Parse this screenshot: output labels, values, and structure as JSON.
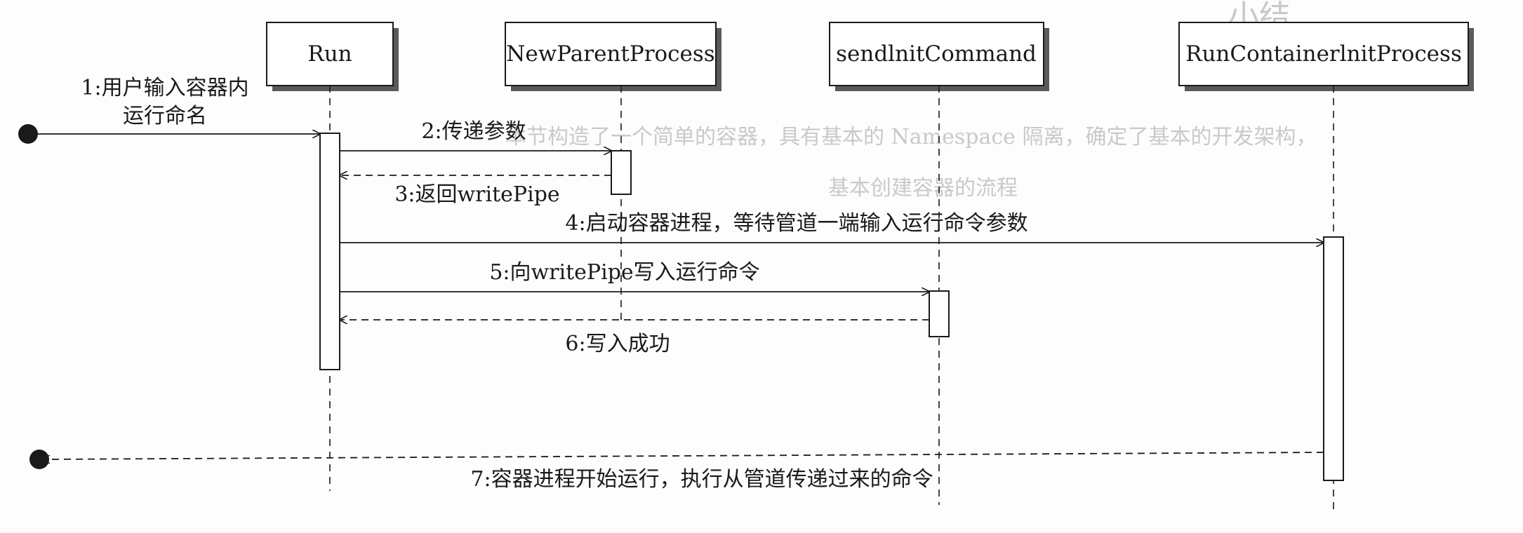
{
  "participants": [
    {
      "id": "run",
      "label": "Run"
    },
    {
      "id": "npp",
      "label": "NewParentProcess"
    },
    {
      "id": "sic",
      "label": "sendlnitCommand"
    },
    {
      "id": "rcip",
      "label": "RunContainerlnitProcess"
    }
  ],
  "messages": [
    {
      "id": "m1",
      "label_lines": [
        "1:用户输入容器内",
        "运行命名"
      ]
    },
    {
      "id": "m2",
      "label": "2:传递参数"
    },
    {
      "id": "m3",
      "label": "3:返回writePipe"
    },
    {
      "id": "m4",
      "label": "4:启动容器进程，等待管道一端输入运行命令参数"
    },
    {
      "id": "m5",
      "label": "5:向writePipe写入运行命令"
    },
    {
      "id": "m6",
      "label": "6:写入成功"
    },
    {
      "id": "m7",
      "label": "7:容器进程开始运行，执行从管道传递过来的命令"
    }
  ],
  "background_bleed": {
    "heading": "小结",
    "line1": "本节构造了一个简单的容器，具有基本的 Namespace 隔离，确定了基本的开发架构，",
    "line2": "基本创建容器的流程"
  }
}
